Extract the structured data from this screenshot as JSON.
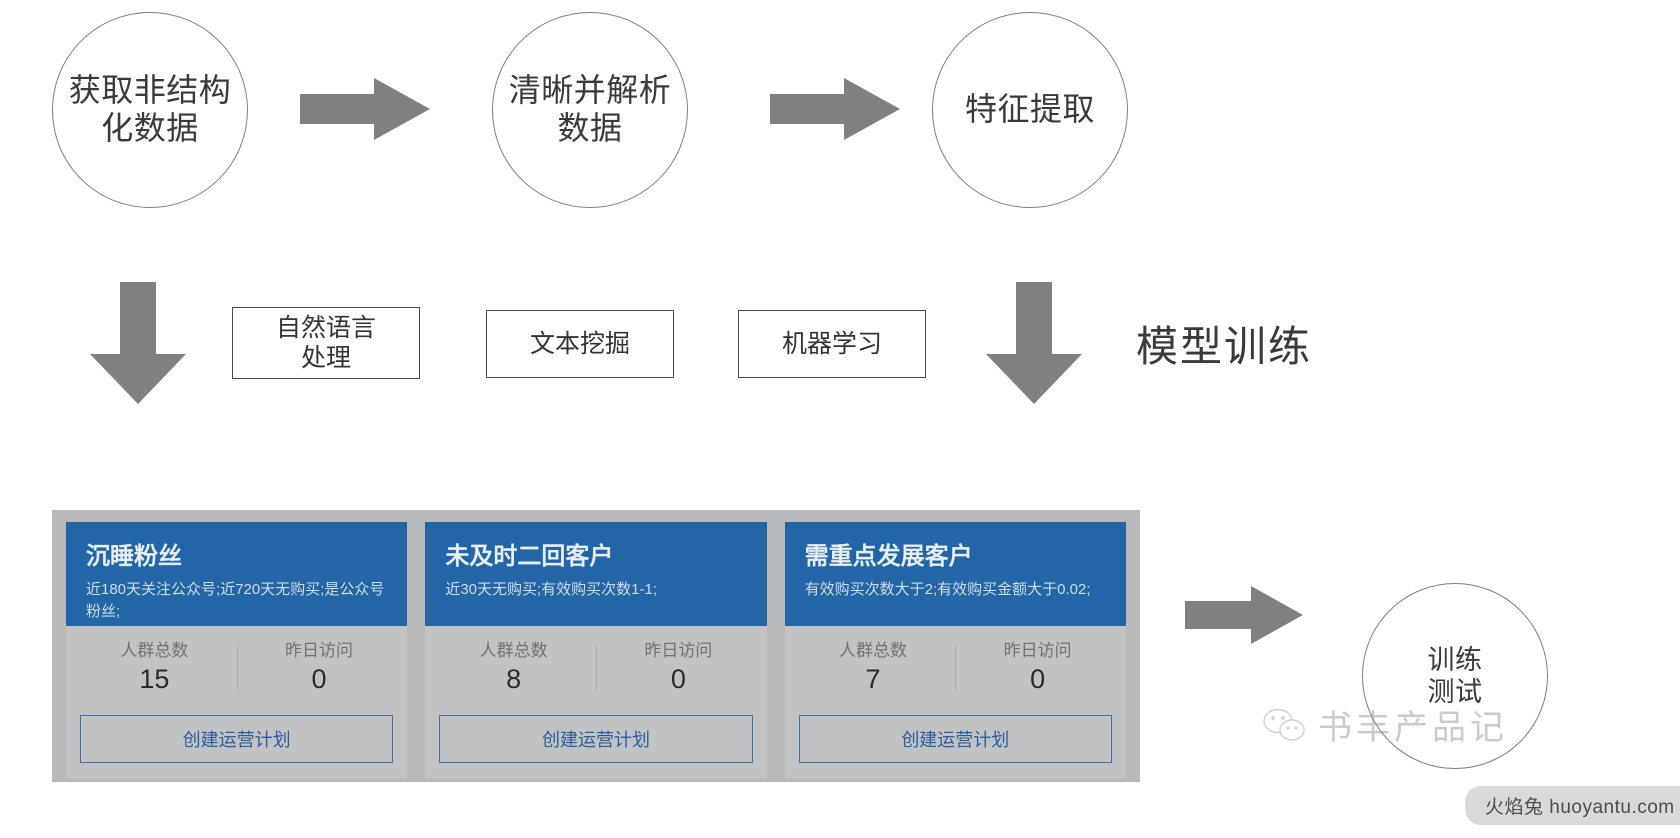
{
  "flow": {
    "circles": [
      {
        "id": "acquire",
        "label": "获取非结构\n化数据"
      },
      {
        "id": "parse",
        "label": "清晰并解析\n数据"
      },
      {
        "id": "feature",
        "label": "特征提取"
      }
    ],
    "arrow_icons": [
      "arrow-right-icon",
      "arrow-right-icon",
      "arrow-down-icon",
      "arrow-down-icon",
      "arrow-right-icon"
    ],
    "tech_boxes": [
      {
        "id": "nlp",
        "label": "自然语言\n处理"
      },
      {
        "id": "text-mining",
        "label": "文本挖掘"
      },
      {
        "id": "machine-learning",
        "label": "机器学习"
      }
    ],
    "model_training_label": "模型训练",
    "train_test_label": "训练\n测试"
  },
  "crowd_panel": {
    "stat_labels": {
      "total": "人群总数",
      "yesterday": "昨日访问"
    },
    "button_label": "创建运营计划",
    "cards": [
      {
        "title": "沉睡粉丝",
        "desc": "近180天关注公众号;近720天无购买;是公众号粉丝;",
        "total": "15",
        "yesterday": "0"
      },
      {
        "title": "未及时二回客户",
        "desc": "近30天无购买;有效购买次数1-1;",
        "total": "8",
        "yesterday": "0"
      },
      {
        "title": "需重点发展客户",
        "desc": "有效购买次数大于2;有效购买金额大于0.02;",
        "total": "7",
        "yesterday": "0"
      }
    ]
  },
  "watermark": {
    "account_name": "书丰产品记",
    "icon": "wechat-icon"
  },
  "site_badge": {
    "text": "火焰兔 huoyantu.com"
  },
  "colors": {
    "card_header_blue": "#2266a8",
    "panel_gray": "#b7b9ba",
    "card_gray": "#c0c2c3",
    "arrow_gray": "#808080",
    "button_blue": "#2a5e9e"
  }
}
